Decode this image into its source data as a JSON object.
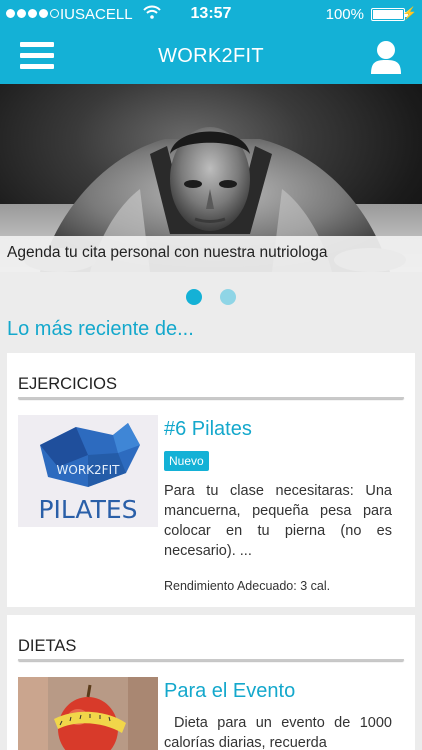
{
  "status_bar": {
    "carrier": "IUSACELL",
    "time": "13:57",
    "battery_percent": "100%",
    "signal_bars_filled": 4,
    "signal_bars_total": 5
  },
  "header": {
    "title": "WORK2FIT",
    "menu_icon": "hamburger-icon",
    "user_icon": "user-icon",
    "color": "#14b1d6"
  },
  "hero": {
    "caption": "Agenda tu cita personal con nuestra nutriologa",
    "slides_total": 2,
    "active_slide": 1
  },
  "section_title": "Lo más reciente de...",
  "cards": [
    {
      "category": "EJERCICIOS",
      "item_title": "#6 Pilates",
      "badge": "Nuevo",
      "description": "Para tu clase necesitaras: Una mancuerna, pequeña pesa para colocar en tu pierna (no es necesario). ...",
      "meta": "Rendimiento Adecuado: 3 cal.",
      "thumb_logo": "WORK2FIT",
      "thumb_label": "PILATES"
    },
    {
      "category": "DIETAS",
      "item_title": "Para el Evento",
      "description": "Dieta para un evento de 1000 calorías diarias, recuerda"
    }
  ]
}
